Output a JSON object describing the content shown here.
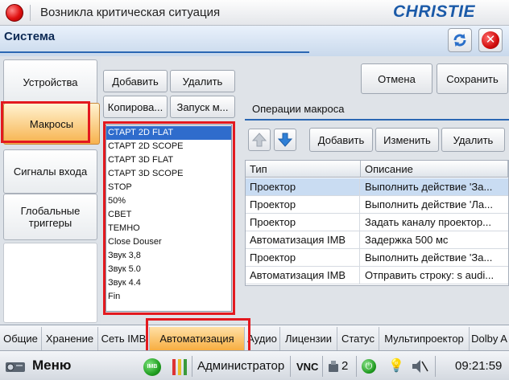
{
  "titlebar": {
    "title": "Возникла критическая ситуация",
    "logo": "CHRISTIE"
  },
  "header": {
    "title": "Система"
  },
  "left_tabs": {
    "devices": "Устройства",
    "macros": "Макросы",
    "input_signals": "Сигналы входа",
    "global_triggers": "Глобальные триггеры"
  },
  "macro_toolbar": {
    "add": "Добавить",
    "delete": "Удалить",
    "copy": "Копирова...",
    "run": "Запуск м..."
  },
  "actions": {
    "cancel": "Отмена",
    "save": "Сохранить"
  },
  "macros": [
    "СТАРТ 2D FLAT",
    "СТАРТ 2D SCOPE",
    "СТАРТ 3D FLAT",
    "СТАРТ 3D SCOPE",
    "STOP",
    "50%",
    "СВЕТ",
    "ТЕМНО",
    "Close Douser",
    "Звук 3,8",
    "Звук 5.0",
    "Звук 4.4",
    "Fin"
  ],
  "selected_macro": "СТАРТ 2D FLAT",
  "operations": {
    "label": "Операции макроса",
    "add": "Добавить",
    "edit": "Изменить",
    "delete": "Удалить",
    "columns": {
      "type": "Тип",
      "description": "Описание"
    },
    "rows": [
      {
        "type": "Проектор",
        "description": "Выполнить действие 'За..."
      },
      {
        "type": "Проектор",
        "description": "Выполнить действие 'Ла..."
      },
      {
        "type": "Проектор",
        "description": "Задать каналу проектор..."
      },
      {
        "type": "Автоматизация IMB",
        "description": "Задержка 500 мс"
      },
      {
        "type": "Проектор",
        "description": "Выполнить действие 'За..."
      },
      {
        "type": "Автоматизация IMB",
        "description": "Отправить строку: s audi..."
      }
    ]
  },
  "bottom_tabs": [
    "Общие",
    "Хранение",
    "Сеть IMB",
    "Автоматизация",
    "Аудио",
    "Лицензии",
    "Статус",
    "Мультипроектор",
    "Dolby A"
  ],
  "active_bottom_tab": "Автоматизация",
  "taskbar": {
    "menu": "Меню",
    "imb_badge": "IMB",
    "user": "Администратор",
    "vnc": "VNC",
    "sessions": "2",
    "time": "09:21:59"
  },
  "icons": {
    "alert": "alert-dot-icon",
    "refresh": "refresh-icon",
    "close": "close-icon",
    "up": "arrow-up-icon",
    "down": "arrow-down-icon"
  },
  "colors": {
    "accent": "#2b67b3",
    "selection": "#2f6ccc",
    "highlight_box": "#e3191f",
    "active_tab": "#f7ac3d"
  }
}
